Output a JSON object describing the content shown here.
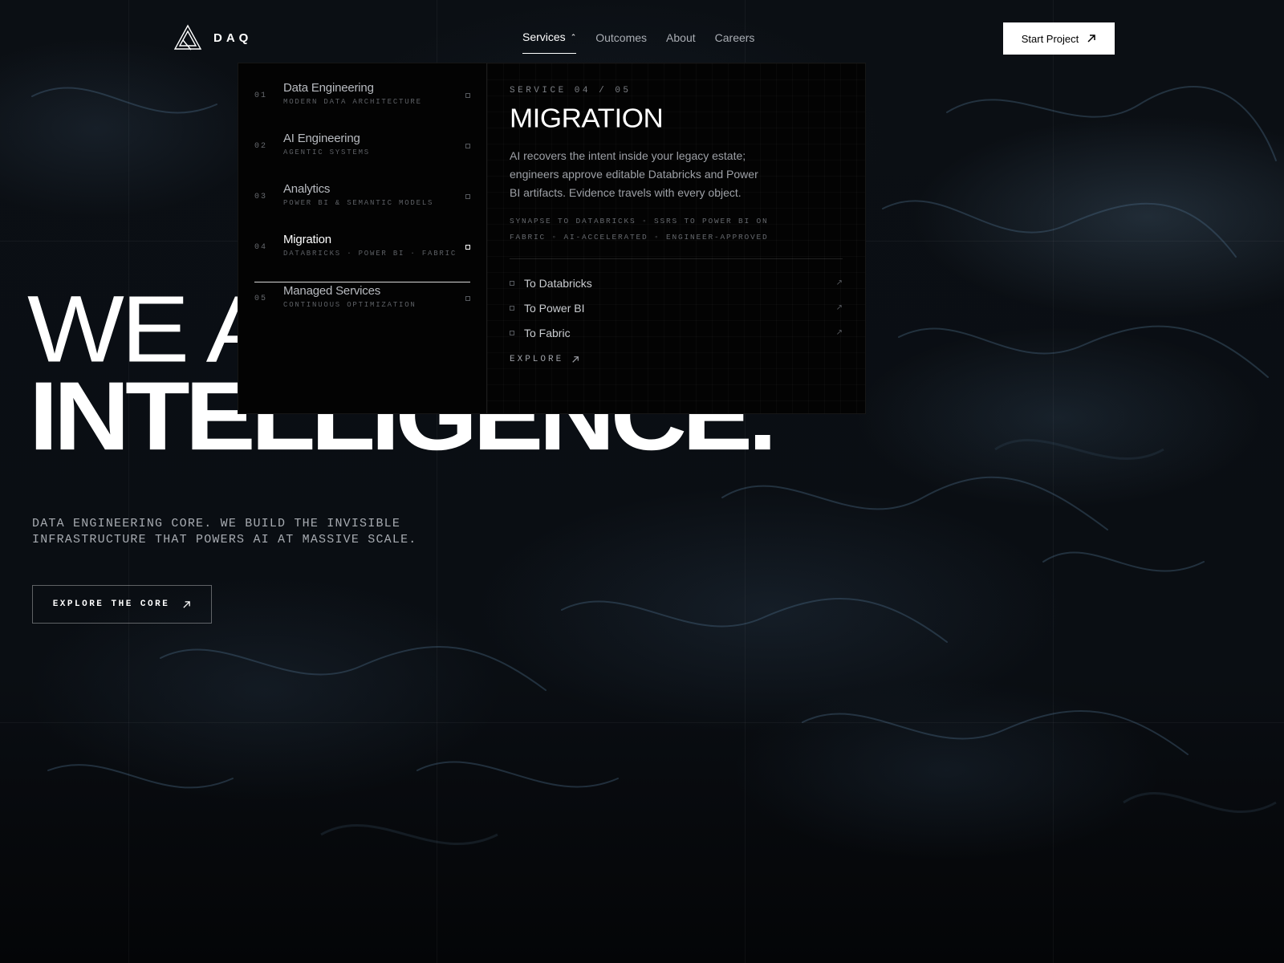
{
  "brand": {
    "name": "DAQ"
  },
  "nav": {
    "items": [
      {
        "label": "Services"
      },
      {
        "label": "Outcomes"
      },
      {
        "label": "About"
      },
      {
        "label": "Careers"
      }
    ],
    "cta_label": "Start Project"
  },
  "hero": {
    "line1": "WE ARCHITECT",
    "line2": "INTELLIGENCE.",
    "subtitle": "DATA ENGINEERING CORE. WE BUILD THE INVISIBLE INFRASTRUCTURE THAT POWERS AI AT MASSIVE SCALE.",
    "cta_label": "EXPLORE THE CORE"
  },
  "services_menu": {
    "items": [
      {
        "num": "01",
        "title": "Data Engineering",
        "sub": "MODERN DATA ARCHITECTURE"
      },
      {
        "num": "02",
        "title": "AI Engineering",
        "sub": "AGENTIC SYSTEMS"
      },
      {
        "num": "03",
        "title": "Analytics",
        "sub": "POWER BI & SEMANTIC MODELS"
      },
      {
        "num": "04",
        "title": "Migration",
        "sub": "DATABRICKS · POWER BI · FABRIC"
      },
      {
        "num": "05",
        "title": "Managed Services",
        "sub": "CONTINUOUS OPTIMIZATION"
      }
    ],
    "active_index": 3,
    "detail": {
      "counter": "SERVICE 04 / 05",
      "heading": "MIGRATION",
      "description": "AI recovers the intent inside your legacy estate; engineers approve editable Databricks and Power BI artifacts. Evidence travels with every object.",
      "tags": "SYNAPSE TO DATABRICKS ◦ SSRS TO POWER BI ON FABRIC ◦ AI-ACCELERATED ◦ ENGINEER-APPROVED",
      "links": [
        {
          "label": "To Databricks"
        },
        {
          "label": "To Power BI"
        },
        {
          "label": "To Fabric"
        }
      ],
      "explore_label": "EXPLORE"
    }
  },
  "colors": {
    "background": "#0a0e13",
    "panel": "#030303",
    "accent": "#ffffff",
    "muted_text": "#9da0a6"
  }
}
